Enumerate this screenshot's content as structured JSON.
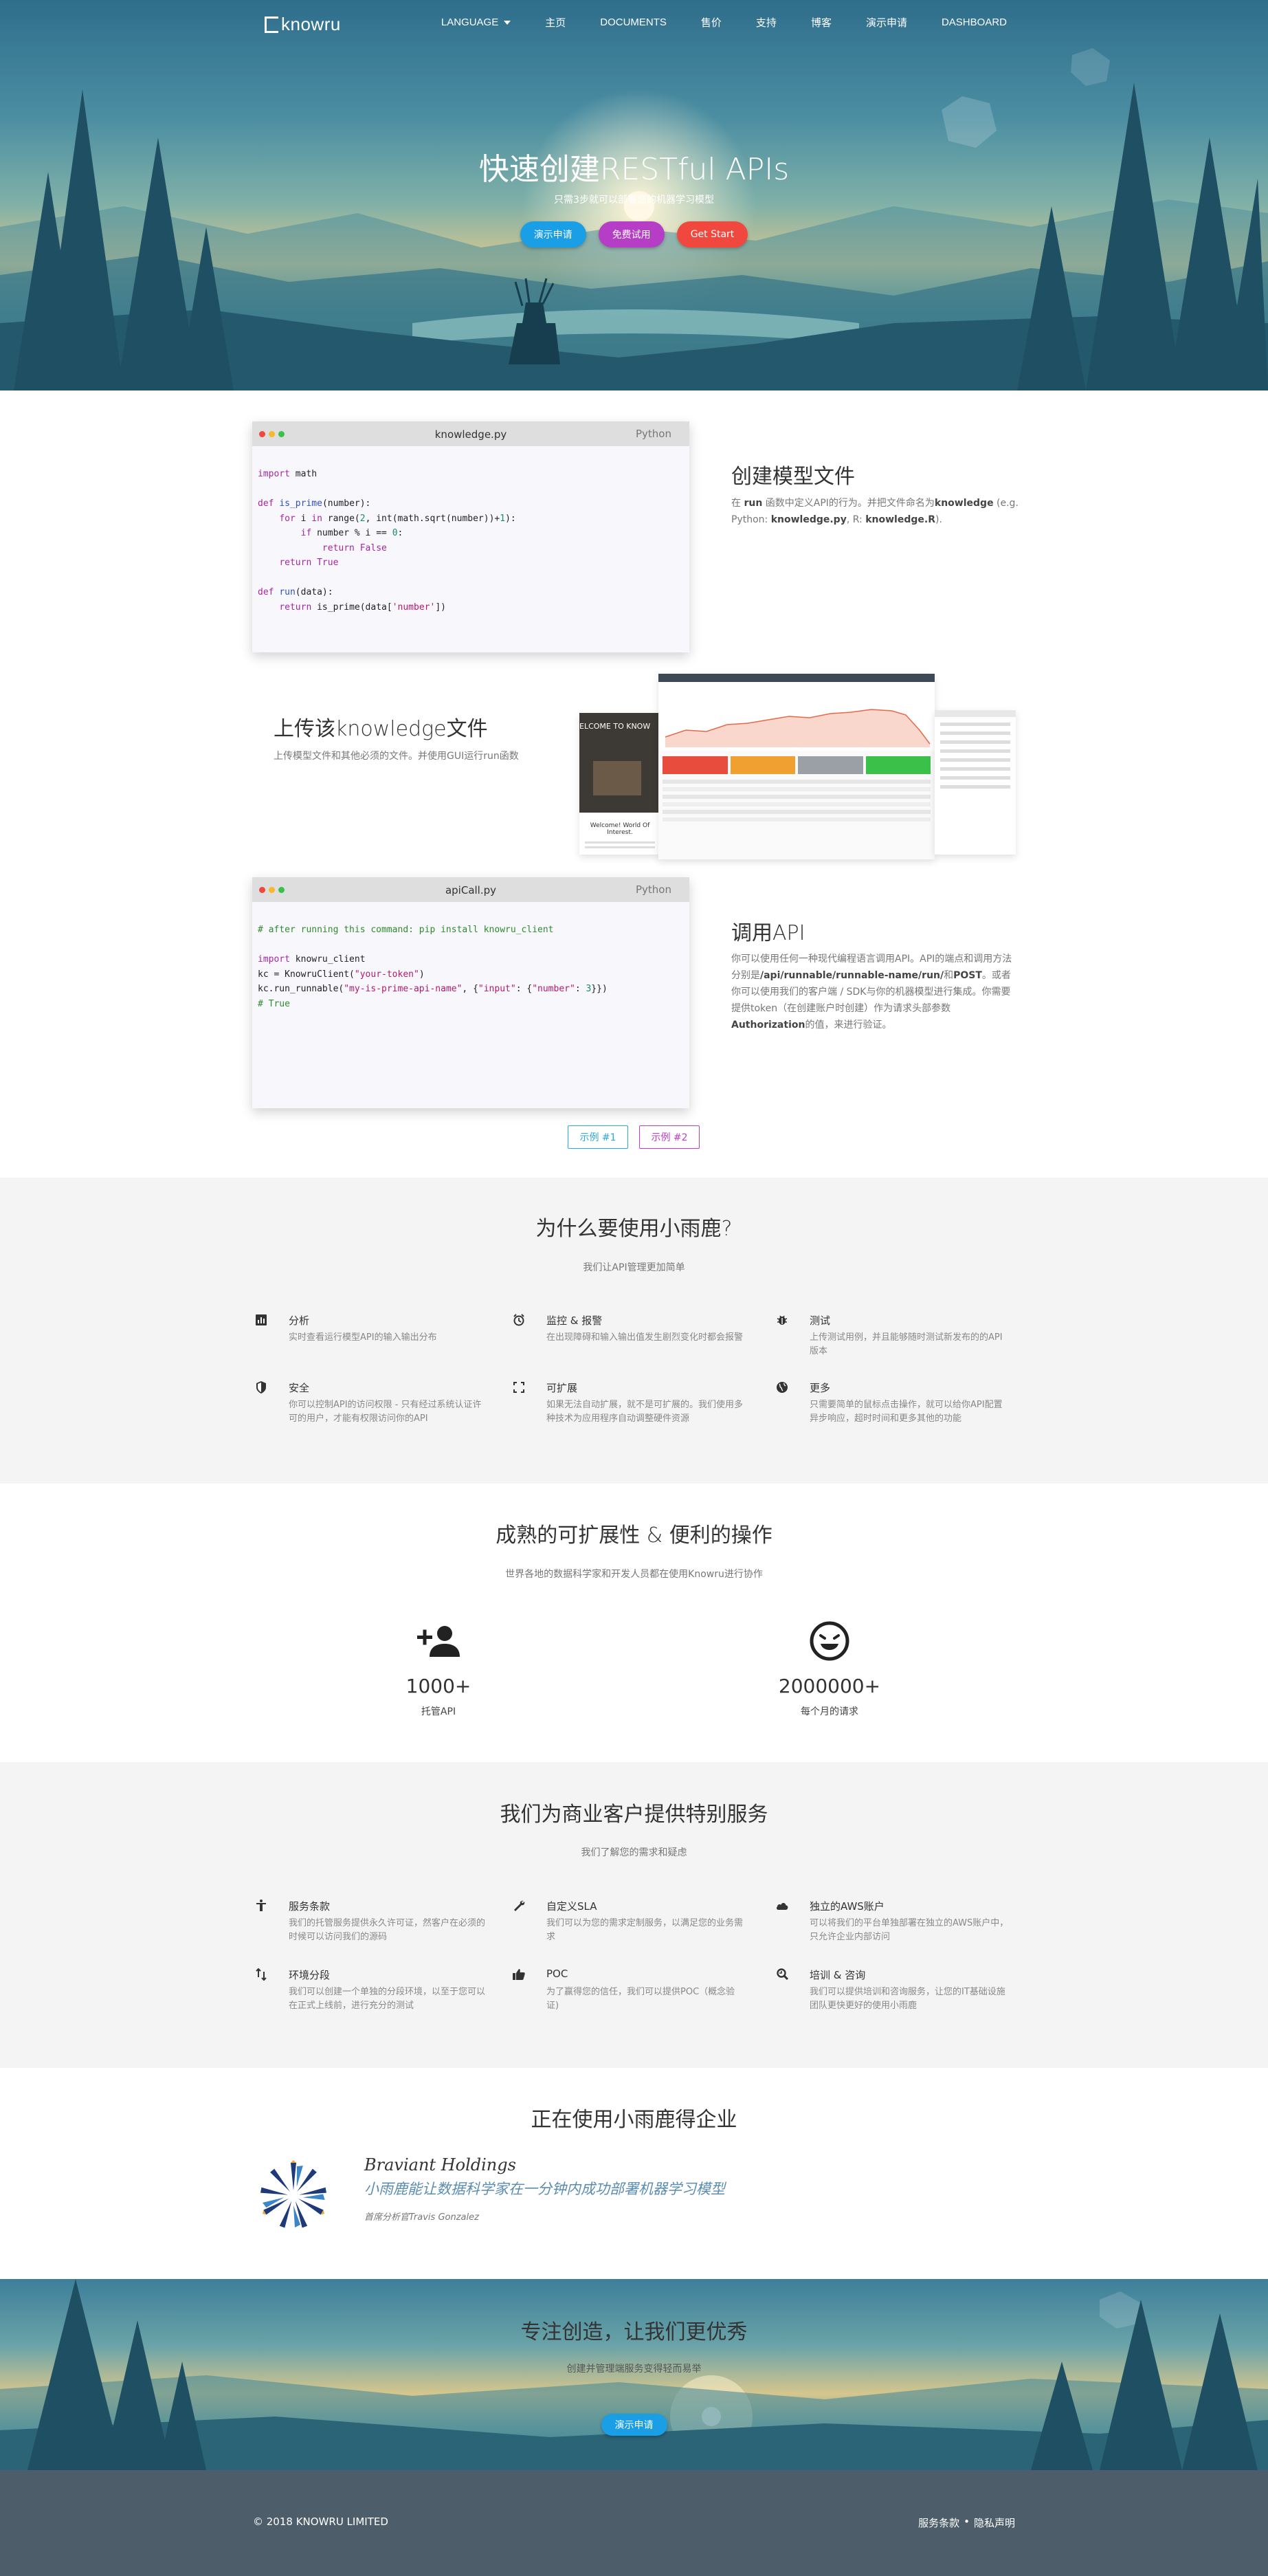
{
  "nav": {
    "logo_text": "knowru",
    "items": [
      {
        "label": "LANGUAGE",
        "has_caret": true
      },
      {
        "label": "主页"
      },
      {
        "label": "DOCUMENTS"
      },
      {
        "label": "售价"
      },
      {
        "label": "支持"
      },
      {
        "label": "博客"
      },
      {
        "label": "演示申请"
      },
      {
        "label": "DASHBOARD"
      }
    ]
  },
  "hero": {
    "title": "快速创建RESTful APIs",
    "subtitle": "只需3步就可以部署您的机器学习模型",
    "buttons": {
      "demo": "演示申请",
      "trial": "免费试用",
      "start": "Get Start"
    }
  },
  "step1": {
    "filename": "knowledge.py",
    "language": "Python",
    "title": "创建模型文件",
    "text_parts": [
      "在 ",
      "run",
      " 函数中定义API的行为。并把文件命名为",
      "knowledge",
      " (e.g. Python: ",
      "knowledge.py",
      ", R: ",
      "knowledge.R",
      ")."
    ]
  },
  "step2": {
    "title": "上传该knowledge文件",
    "text": "上传模型文件和其他必须的文件。并使用GUI运行run函数",
    "shot_banner": "ELCOME TO KNOW",
    "shot_welcome": "Welcome! World Of Interest."
  },
  "step3": {
    "filename": "apiCall.py",
    "language": "Python",
    "title": "调用API",
    "text_parts": [
      "你可以使用任何一种现代编程语言调用API。API的端点和调用方法分别是",
      "/api/runnable/runnable-name/run/",
      "和",
      "POST",
      "。或者你可以使用我们的客户端 / SDK与你的机器模型进行集成。你需要提供token（在创建账户时创建）作为请求头部参数",
      "Authorization",
      "的值，来进行验证。"
    ],
    "examples": [
      "示例 #1",
      "示例 #2"
    ]
  },
  "why": {
    "title": "为什么要使用小雨鹿?",
    "subtitle": "我们让API管理更加简单",
    "items": [
      {
        "icon": "chart-icon",
        "title": "分析",
        "text": "实时查看运行模型API的输入输出分布"
      },
      {
        "icon": "alarm-icon",
        "title": "监控 & 报警",
        "text": "在出现障碍和输入输出值发生剧烈变化时都会报警"
      },
      {
        "icon": "bug-icon",
        "title": "测试",
        "text": "上传测试用例，并且能够随时测试新发布的的API版本"
      },
      {
        "icon": "shield-icon",
        "title": "安全",
        "text": "你可以控制API的访问权限 - 只有经过系统认证许可的用户，才能有权限访问你的API"
      },
      {
        "icon": "expand-icon",
        "title": "可扩展",
        "text": "如果无法自动扩展，就不是可扩展的。我们使用多种技术为应用程序自动调整硬件资源"
      },
      {
        "icon": "globe-icon",
        "title": "更多",
        "text": "只需要简单的鼠标点击操作，就可以给你API配置异步响应，超时时间和更多其他的功能"
      }
    ]
  },
  "scale": {
    "title": "成熟的可扩展性 & 便利的操作",
    "subtitle": "世界各地的数据科学家和开发人员都在使用Knowru进行协作",
    "stats": [
      {
        "icon": "person-add-icon",
        "value": "1000+",
        "label": "托管API"
      },
      {
        "icon": "smiley-icon",
        "value": "2000000+",
        "label": "每个月的请求"
      }
    ]
  },
  "business": {
    "title": "我们为商业客户提供特别服务",
    "subtitle": "我们了解您的需求和疑虑",
    "items": [
      {
        "icon": "accessibility-icon",
        "title": "服务条款",
        "text": "我们的托管服务提供永久许可证，然客户在必须的时候可以访问我们的源码"
      },
      {
        "icon": "wrench-icon",
        "title": "自定义SLA",
        "text": "我们可以为您的需求定制服务，以满足您的业务需求"
      },
      {
        "icon": "cloud-icon",
        "title": "独立的AWS账户",
        "text": "可以将我们的平台单独部署在独立的AWS账户中，只允许企业内部访问"
      },
      {
        "icon": "swap-icon",
        "title": "环境分段",
        "text": "我们可以创建一个单独的分段环境，以至于您可以在正式上线前，进行充分的测试"
      },
      {
        "icon": "thumb-up-icon",
        "title": "POC",
        "text": "为了赢得您的信任，我们可以提供POC（概念验证)"
      },
      {
        "icon": "support-icon",
        "title": "培训 & 咨询",
        "text": "我们可以提供培训和咨询服务，让您的IT基础设施团队更快更好的使用小雨鹿"
      }
    ]
  },
  "clients": {
    "title": "正在使用小雨鹿得企业",
    "company": "Braviant Holdings",
    "quote": "小雨鹿能让数据科学家在一分钟内成功部署机器学习模型",
    "attribution": "首席分析官Travis Gonzalez"
  },
  "cta": {
    "title": "专注创造，让我们更优秀",
    "subtitle": "创建并管理端服务变得轻而易举",
    "button": "演示申请"
  },
  "footer": {
    "copyright": "© 2018 KNOWRU LIMITED",
    "terms": "服务条款",
    "separator": "•",
    "privacy": "隐私声明"
  },
  "colors": {
    "blue": "#1a9ee6",
    "purple": "#b63ec6",
    "red": "#f0483e",
    "footer_bg": "#4d5e6a"
  }
}
